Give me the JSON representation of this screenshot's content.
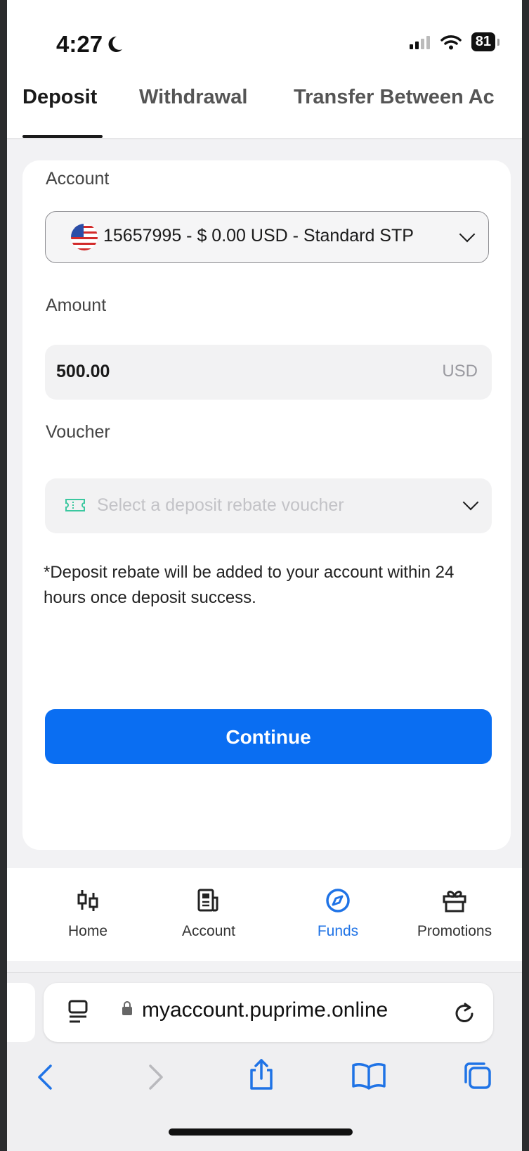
{
  "status_bar": {
    "time": "4:27",
    "battery": "81"
  },
  "tabs": [
    {
      "label": "Deposit",
      "active": true
    },
    {
      "label": "Withdrawal",
      "active": false
    },
    {
      "label": "Transfer Between Ac",
      "active": false
    }
  ],
  "form": {
    "account_label": "Account",
    "account_value": "15657995 - $ 0.00 USD - Standard STP",
    "amount_label": "Amount",
    "amount_value": "500.00",
    "amount_unit": "USD",
    "voucher_label": "Voucher",
    "voucher_placeholder": "Select a deposit rebate voucher",
    "note": "*Deposit rebate will be added to your account within 24 hours once deposit success.",
    "continue_label": "Continue"
  },
  "bottom_nav": [
    {
      "label": "Home",
      "icon": "candlestick-icon",
      "active": false
    },
    {
      "label": "Account",
      "icon": "document-icon",
      "active": false
    },
    {
      "label": "Funds",
      "icon": "compass-icon",
      "active": true
    },
    {
      "label": "Promotions",
      "icon": "gift-icon",
      "active": false
    }
  ],
  "browser": {
    "url": "myaccount.puprime.online"
  },
  "colors": {
    "accent": "#0a6ef2",
    "nav_active": "#1f73e6",
    "voucher_icon": "#3cc8a0"
  }
}
